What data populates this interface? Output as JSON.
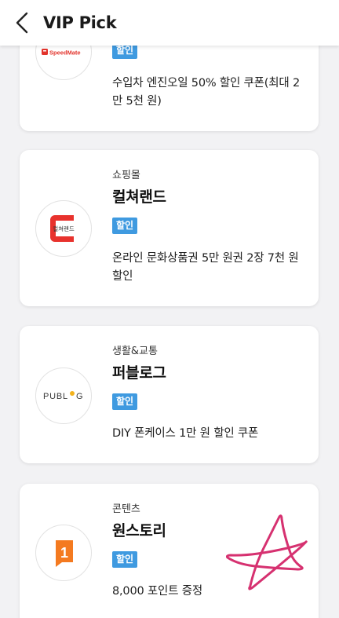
{
  "header": {
    "title": "VIP Pick",
    "back_icon": "chevron-left-icon"
  },
  "cards": [
    {
      "category": "",
      "brand": "",
      "logo_text": "SpeedMate",
      "logo_color": "#e2332b",
      "badge": "할인",
      "description": "수입차 엔진오일 50% 할인 쿠폰(최대 2만 5천 원)"
    },
    {
      "category": "쇼핑몰",
      "brand": "컬쳐랜드",
      "logo_text": "컬쳐랜드",
      "logo_color": "#e8322d",
      "badge": "할인",
      "description": "온라인 문화상품권 5만 원권 2장 7천 원 할인"
    },
    {
      "category": "생활&교통",
      "brand": "퍼블로그",
      "logo_text_left": "PUBL",
      "logo_text_right": "G",
      "logo_dot_color": "#f3b21c",
      "badge": "할인",
      "description": "DIY 폰케이스 1만 원 할인 쿠폰"
    },
    {
      "category": "콘텐츠",
      "brand": "원스토리",
      "logo_text": "1",
      "logo_color": "#f47a20",
      "badge": "할인",
      "description": "8,000 포인트 증정"
    }
  ],
  "colors": {
    "badge": "#3f9ae0",
    "background": "#f2f2f4",
    "star_mark": "#d63170"
  }
}
